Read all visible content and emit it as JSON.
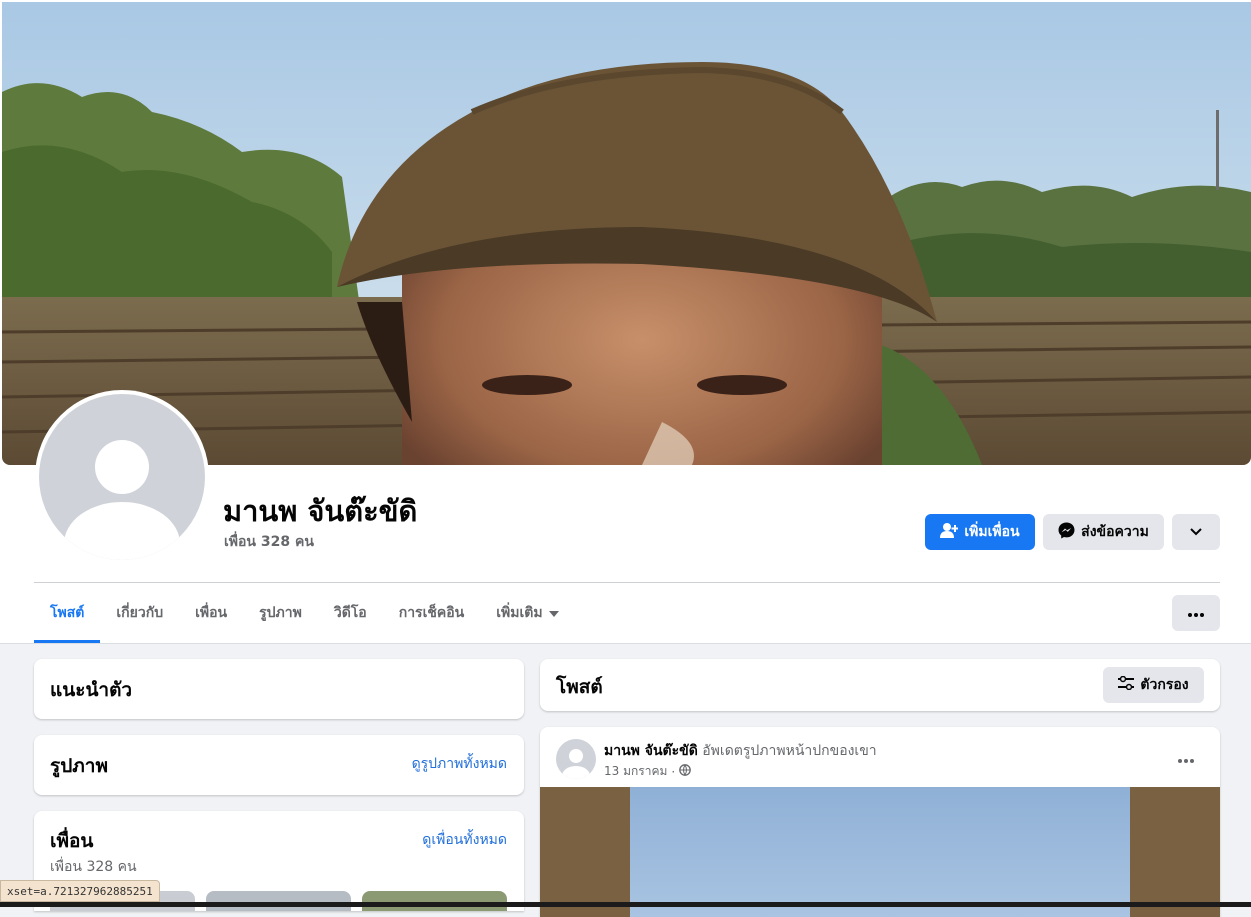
{
  "profile": {
    "name": "มานพ จันต๊ะขัดิ",
    "friends_count": "เพื่อน 328 คน"
  },
  "actions": {
    "add_friend": "เพิ่มเพื่อน",
    "message": "ส่งข้อความ"
  },
  "tabs": [
    {
      "label": "โพสต์"
    },
    {
      "label": "เกี่ยวกับ"
    },
    {
      "label": "เพื่อน"
    },
    {
      "label": "รูปภาพ"
    },
    {
      "label": "วิดีโอ"
    },
    {
      "label": "การเช็คอิน"
    },
    {
      "label": "เพิ่มเติม"
    }
  ],
  "sidebar": {
    "intro_title": "แนะนำตัว",
    "photos_title": "รูปภาพ",
    "photos_link": "ดูรูปภาพทั้งหมด",
    "friends_title": "เพื่อน",
    "friends_link": "ดูเพื่อนทั้งหมด",
    "friends_count": "เพื่อน 328 คน"
  },
  "posts_header": {
    "title": "โพสต์",
    "filter_label": "ตัวกรอง"
  },
  "post": {
    "author": "มานพ จันต๊ะขัดิ",
    "action": "อัพเดตรูปภาพหน้าปกของเขา",
    "date": "13 มกราคม",
    "separator": "·"
  },
  "status_bar": {
    "url": "xset=a.721327962885251"
  },
  "colors": {
    "accent": "#1877f2",
    "link": "#216fdb",
    "background": "#f0f2f5"
  }
}
